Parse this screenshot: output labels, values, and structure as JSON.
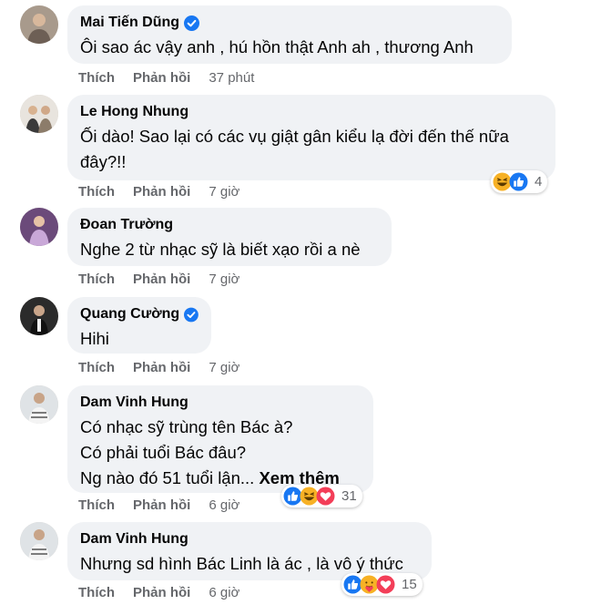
{
  "comments": [
    {
      "author": "Mai Tiến Dũng",
      "verified": true,
      "lines": [
        "Ôi sao ác vậy anh , hú hồn thật Anh ah , thương Anh"
      ],
      "like_label": "Thích",
      "reply_label": "Phản hồi",
      "time": "37 phút"
    },
    {
      "author": "Le Hong Nhung",
      "verified": false,
      "lines": [
        "Ối dào! Sao lại có các vụ giật gân kiểu lạ đời đến thế nữa",
        "đây?!!"
      ],
      "like_label": "Thích",
      "reply_label": "Phản hồi",
      "time": "7 giờ",
      "reaction_icons": [
        "haha-icon",
        "like-icon"
      ],
      "reaction_count": "4"
    },
    {
      "author": "Đoan Trường",
      "verified": false,
      "lines": [
        "Nghe 2 từ nhạc sỹ là biết xạo rồi a nè"
      ],
      "like_label": "Thích",
      "reply_label": "Phản hồi",
      "time": "7 giờ"
    },
    {
      "author": "Quang Cường",
      "verified": true,
      "lines": [
        "Hihi"
      ],
      "like_label": "Thích",
      "reply_label": "Phản hồi",
      "time": "7 giờ"
    },
    {
      "author": "Dam Vinh Hung",
      "verified": false,
      "lines": [
        "Có nhạc sỹ trùng tên Bác à?",
        "Có phải tuổi Bác đâu?",
        "Ng nào đó 51 tuổi lận..."
      ],
      "see_more": "Xem thêm",
      "like_label": "Thích",
      "reply_label": "Phản hồi",
      "time": "6 giờ",
      "reaction_icons": [
        "like-icon",
        "haha-icon",
        "love-icon"
      ],
      "reaction_count": "31"
    },
    {
      "author": "Dam Vinh Hung",
      "verified": false,
      "lines": [
        "Nhưng sd hình Bác Linh là ác , là vô ý thức"
      ],
      "like_label": "Thích",
      "reply_label": "Phản hồi",
      "time": "6 giờ",
      "reaction_icons": [
        "like-icon",
        "care-icon",
        "love-icon"
      ],
      "reaction_count": "15"
    }
  ],
  "colors": {
    "bubble": "#f0f2f5",
    "meta_text": "#65676b",
    "verified": "#1877f2",
    "like": "#1877f2",
    "love": "#f33e58",
    "haha": "#f7b125"
  }
}
